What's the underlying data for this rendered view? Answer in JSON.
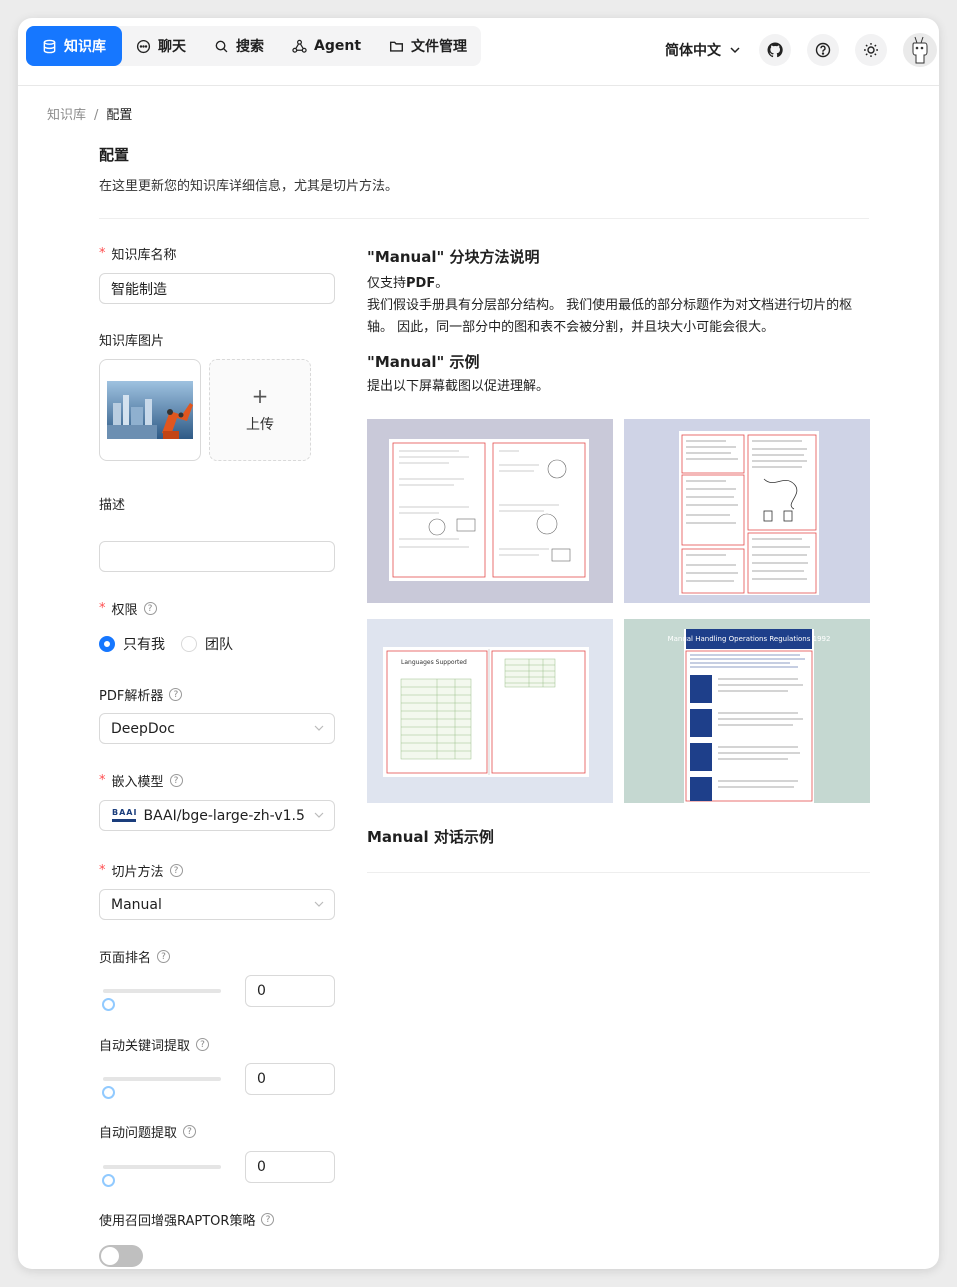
{
  "nav": {
    "items": [
      {
        "label": "知识库",
        "icon": "database-icon",
        "active": true
      },
      {
        "label": "聊天",
        "icon": "chat-icon"
      },
      {
        "label": "搜索",
        "icon": "search-icon"
      },
      {
        "label": "Agent",
        "icon": "agent-icon"
      },
      {
        "label": "文件管理",
        "icon": "folder-icon"
      }
    ],
    "language": "简体中文"
  },
  "breadcrumb": {
    "root": "知识库",
    "sep": "/",
    "current": "配置"
  },
  "header": {
    "title": "配置",
    "subtitle": "在这里更新您的知识库详细信息，尤其是切片方法。"
  },
  "form": {
    "name_label": "知识库名称",
    "name_value": "智能制造",
    "image_label": "知识库图片",
    "upload_label": "上传",
    "description_label": "描述",
    "description_value": "",
    "permission_label": "权限",
    "permission_options": [
      "只有我",
      "团队"
    ],
    "permission_selected": "只有我",
    "pdf_parser_label": "PDF解析器",
    "pdf_parser_value": "DeepDoc",
    "embedding_label": "嵌入模型",
    "embedding_value": "BAAI/bge-large-zh-v1.5",
    "embedding_logo_text": "BAAI",
    "chunk_method_label": "切片方法",
    "chunk_method_value": "Manual",
    "page_rank_label": "页面排名",
    "page_rank_value": "0",
    "auto_keywords_label": "自动关键词提取",
    "auto_keywords_value": "0",
    "auto_questions_label": "自动问题提取",
    "auto_questions_value": "0",
    "raptor_label": "使用召回增强RAPTOR策略",
    "raptor_enabled": false
  },
  "description_panel": {
    "method_title": "\"Manual\" 分块方法说明",
    "method_line1_prefix": "仅支持",
    "method_line1_bold": "PDF",
    "method_line1_suffix": "。",
    "method_line2": "我们假设手册具有分层部分结构。 我们使用最低的部分标题作为对文档进行切片的枢轴。 因此，同一部分中的图和表不会被分割，并且块大小可能会很大。",
    "example_title": "\"Manual\" 示例",
    "example_desc": "提出以下屏幕截图以促进理解。",
    "sample4_title": "Manual Handling Operations Regulations 1992",
    "sample3_title": "Languages Supported",
    "dialog_title": "Manual 对话示例"
  },
  "colors": {
    "accent": "#1677ff",
    "required": "#ff4d4f"
  }
}
